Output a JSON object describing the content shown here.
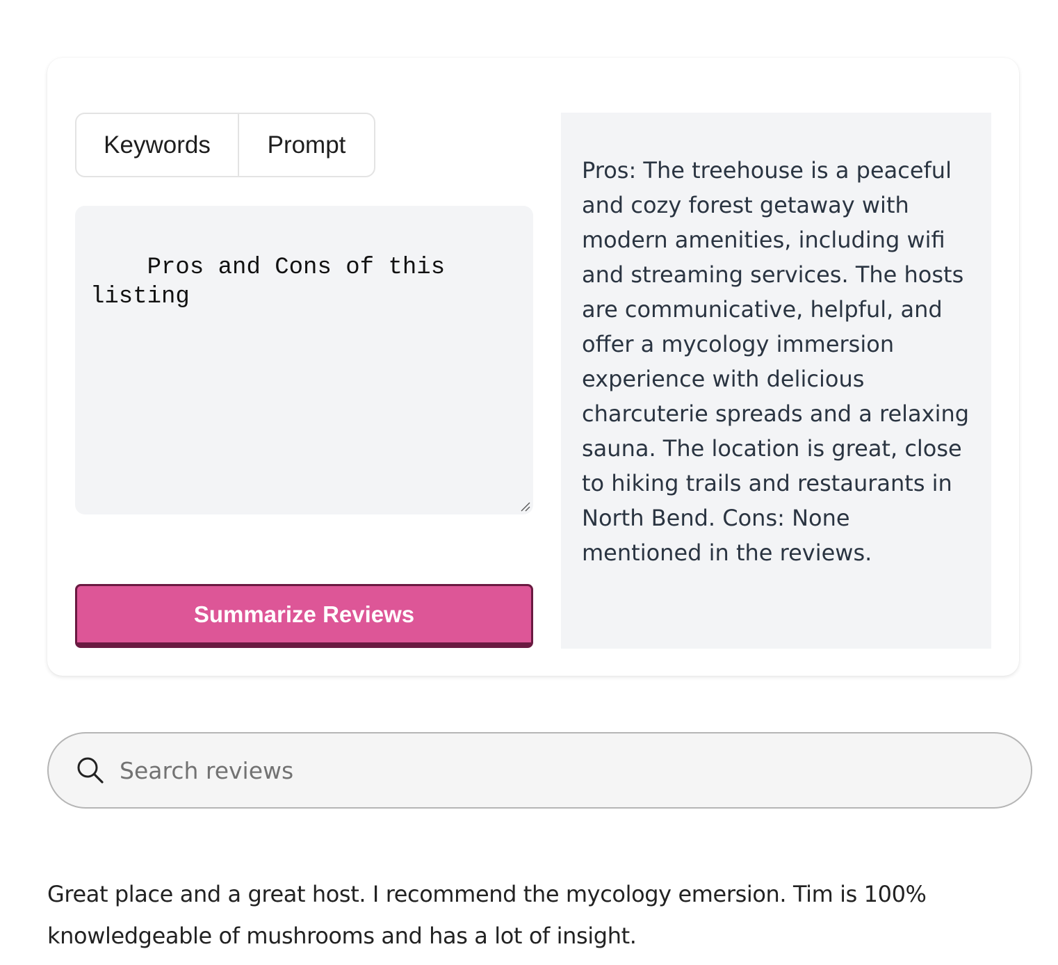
{
  "tabs": [
    {
      "label": "Keywords"
    },
    {
      "label": "Prompt"
    }
  ],
  "prompt": {
    "value": "Pros and Cons of this listing"
  },
  "actions": {
    "summarize_label": "Summarize Reviews"
  },
  "summary": {
    "text": "Pros: The treehouse is a peaceful and cozy forest getaway with modern amenities, including wifi and streaming services. The hosts are communicative, helpful, and offer a mycology immersion experience with delicious charcuterie spreads and a relaxing sauna. The location is great, close to hiking trails and restaurants in North Bend. Cons: None mentioned in the reviews."
  },
  "search": {
    "placeholder": "Search reviews",
    "value": "",
    "icon": "search-icon"
  },
  "reviews": [
    {
      "text": "Great place and a great host. I recommend the mycology emersion. Tim is 100% knowledgeable of mushrooms and has a lot of insight."
    }
  ],
  "colors": {
    "accent": "#dd5697",
    "accent_border": "#6a1a41",
    "panel_bg": "#f3f4f6",
    "summary_text": "#2a3441"
  }
}
